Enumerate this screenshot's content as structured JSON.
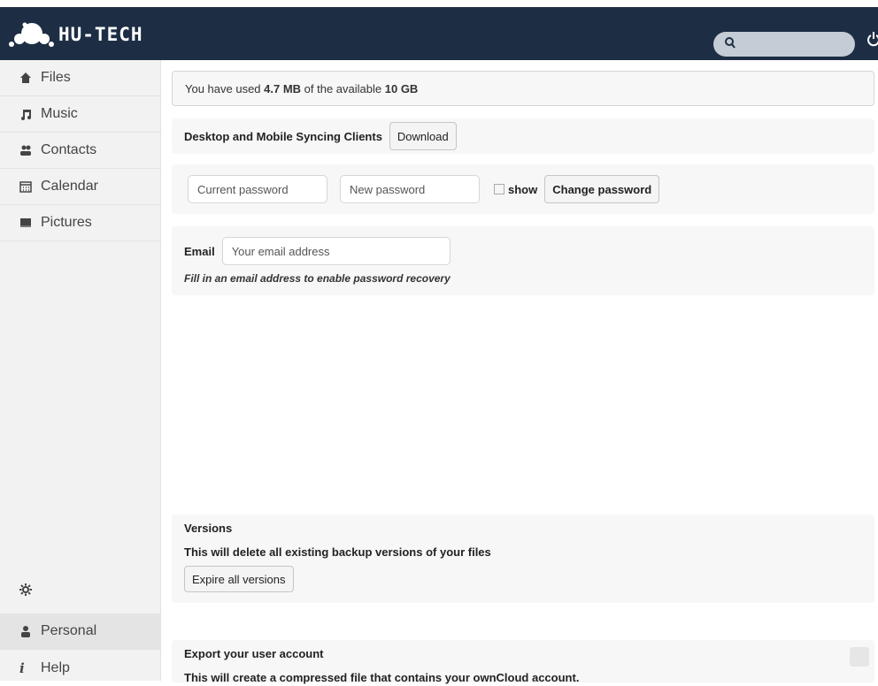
{
  "app": {
    "logo_text": "HU-TECH",
    "accent": "#1d2d44"
  },
  "header": {
    "search_placeholder": "",
    "search_icon": "search-icon",
    "power_icon": "power-icon"
  },
  "sidebar": {
    "items": [
      {
        "label": "Files",
        "icon": "home-icon"
      },
      {
        "label": "Music",
        "icon": "music-icon"
      },
      {
        "label": "Contacts",
        "icon": "contacts-icon"
      },
      {
        "label": "Calendar",
        "icon": "calendar-icon"
      },
      {
        "label": "Pictures",
        "icon": "image-icon"
      }
    ],
    "settings_icon": "gear-icon",
    "bottom_items": [
      {
        "label": "Personal",
        "icon": "user-icon"
      },
      {
        "label": "Help",
        "icon": "info-icon"
      }
    ]
  },
  "usage": {
    "prefix": "You have used ",
    "used": "4.7 MB",
    "middle": " of the available ",
    "total": "10 GB"
  },
  "sync": {
    "label": "Desktop and Mobile Syncing Clients",
    "download_label": "Download"
  },
  "password": {
    "current_placeholder": "Current password",
    "new_placeholder": "New password",
    "show_label": "show",
    "change_label": "Change password"
  },
  "email": {
    "label": "Email",
    "placeholder": "Your email address",
    "hint": "Fill in an email address to enable password recovery"
  },
  "versions": {
    "title": "Versions",
    "description": "This will delete all existing backup versions of your files",
    "button_label": "Expire all versions"
  },
  "export": {
    "title": "Export your user account",
    "description": "This will create a compressed file that contains your ownCloud account."
  }
}
